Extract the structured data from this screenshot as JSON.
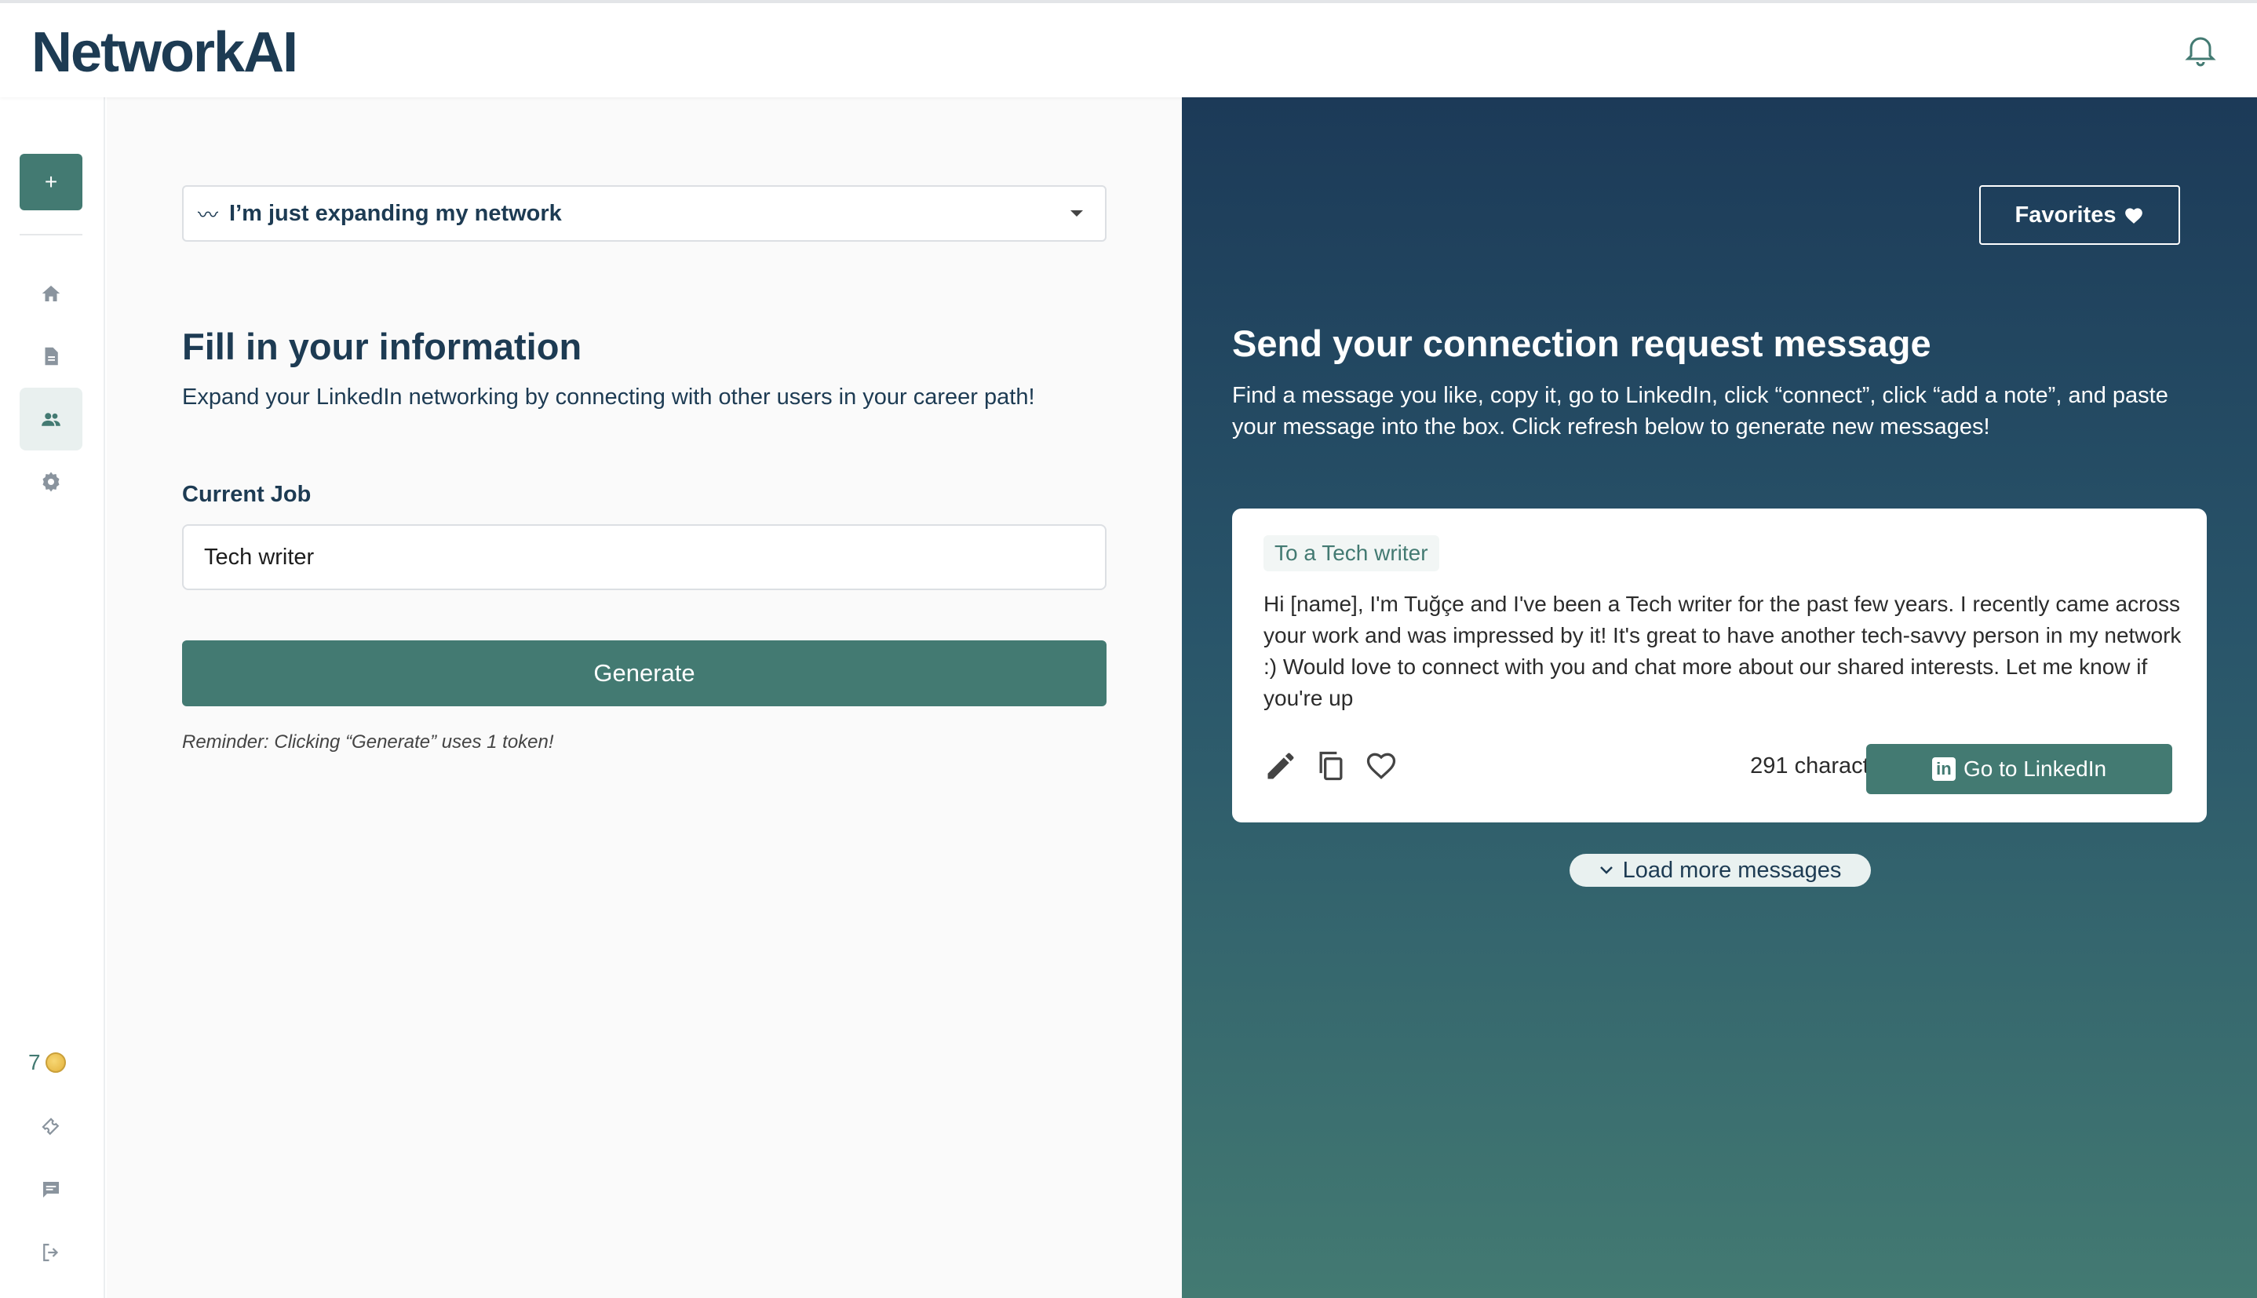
{
  "app": {
    "logo": "NetworkAI"
  },
  "header": {
    "bell_icon": "bell-icon"
  },
  "sidebar": {
    "new_button_label": "+",
    "items": [
      {
        "icon": "home-icon"
      },
      {
        "icon": "document-icon"
      },
      {
        "icon": "people-icon",
        "active": true
      },
      {
        "icon": "gear-icon"
      }
    ],
    "tokens": "7",
    "bottom_items": [
      {
        "icon": "ticket-icon"
      },
      {
        "icon": "chat-icon"
      },
      {
        "icon": "logout-icon"
      }
    ]
  },
  "form": {
    "intent_selected": "I’m just expanding my network",
    "title": "Fill in your information",
    "subtitle": "Expand your LinkedIn networking by connecting with other users in your career path!",
    "job_label": "Current Job",
    "job_value": "Tech writer",
    "generate_label": "Generate",
    "reminder": "Reminder: Clicking “Generate” uses 1 token!"
  },
  "results": {
    "favorites_label": "Favorites",
    "title": "Send your connection request message",
    "subtitle": "Find a message you like, copy it, go to LinkedIn, click “connect”, click “add a note”, and paste your message into the box. Click refresh below to generate new messages!",
    "message": {
      "recipient": "To a Tech writer",
      "body": "Hi [name], I'm Tuğçe and I've been a Tech writer for the past few years. I recently came across your work and was impressed by it! It's great to have another tech-savvy person in my network :) Would love to connect with you and chat more about our shared interests. Let me know if you're up",
      "char_count": "291 characters",
      "linkedin_label": "Go to LinkedIn",
      "linkedin_logo": "in"
    },
    "load_more_label": "Load more messages"
  },
  "colors": {
    "primary": "#437a72",
    "navy": "#1d3b53",
    "panel_top": "#1c3a58",
    "panel_bottom": "#437a72"
  }
}
